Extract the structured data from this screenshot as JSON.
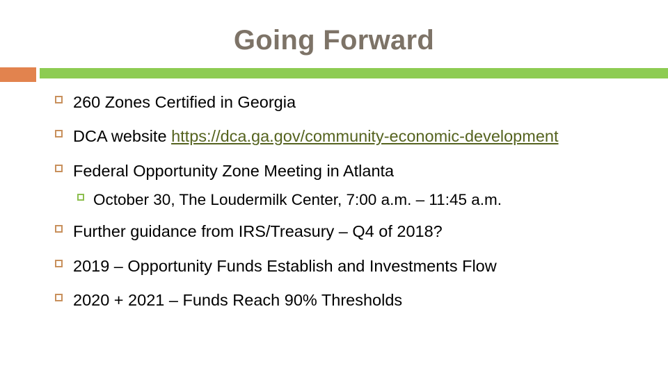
{
  "slide": {
    "title": "Going Forward",
    "title_color": "#7d7367",
    "accent_bar_color": "#e2834e",
    "rule_color": "#8dcc52",
    "bullet_marker_color": "#c8905c",
    "sub_bullet_marker_color": "#8dbf4f",
    "hyperlink_color": "#55631f",
    "background_color": "#ffffff"
  },
  "bullets": [
    {
      "text": "260 Zones Certified in Georgia",
      "marker": "hollow-square-orange"
    },
    {
      "text_before_link": "DCA website ",
      "link_text": "https://dca.ga.gov/community-economic-development",
      "marker": "hollow-square-orange"
    },
    {
      "text": "Federal Opportunity Zone Meeting in Atlanta",
      "marker": "hollow-square-orange",
      "sub_bullets": [
        {
          "text": "October 30, The Loudermilk Center, 7:00 a.m. – 11:45 a.m.",
          "marker": "hollow-square-green"
        }
      ]
    },
    {
      "text": "Further guidance from IRS/Treasury – Q4 of 2018?",
      "marker": "hollow-square-orange"
    },
    {
      "text": "2019 – Opportunity Funds Establish and Investments Flow",
      "marker": "hollow-square-orange"
    },
    {
      "text": "2020 + 2021 – Funds Reach 90% Thresholds",
      "marker": "hollow-square-orange"
    }
  ]
}
